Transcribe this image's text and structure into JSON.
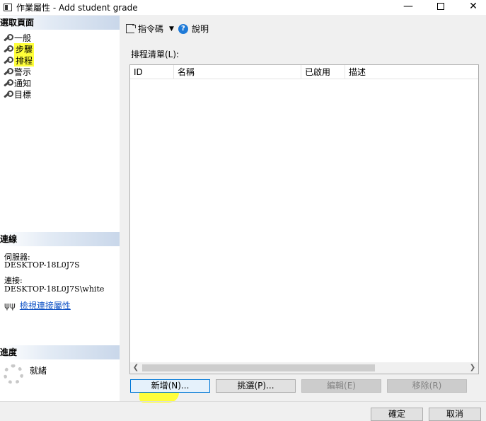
{
  "window": {
    "title": "作業屬性 - Add student grade",
    "minimize": "—",
    "close": "✕"
  },
  "left_panel": {
    "pages_header": "選取頁面",
    "pages": [
      {
        "label": "一般"
      },
      {
        "label": "步驟"
      },
      {
        "label": "排程"
      },
      {
        "label": "警示"
      },
      {
        "label": "通知"
      },
      {
        "label": "目標"
      }
    ],
    "connection_header": "連線",
    "server_label": "伺服器:",
    "server_value": "DESKTOP-18L0J7S",
    "connection_label": "連接:",
    "connection_value": "DESKTOP-18L0J7S\\white",
    "view_connection_link": "檢視連接屬性",
    "progress_header": "進度",
    "progress_status": "就緒"
  },
  "toolbar": {
    "script_label": "指令碼",
    "help_label": "說明"
  },
  "schedule": {
    "list_label": "排程清單(L):",
    "columns": [
      "ID",
      "名稱",
      "已啟用",
      "描述"
    ],
    "rows": []
  },
  "buttons": {
    "new": "新增(N)...",
    "pick": "挑選(P)...",
    "edit": "編輯(E)",
    "remove": "移除(R)",
    "ok": "確定",
    "cancel": "取消"
  },
  "colors": {
    "highlight": "#ffff3a",
    "link": "#0b4fc4",
    "help_icon": "#1e7ad8"
  }
}
